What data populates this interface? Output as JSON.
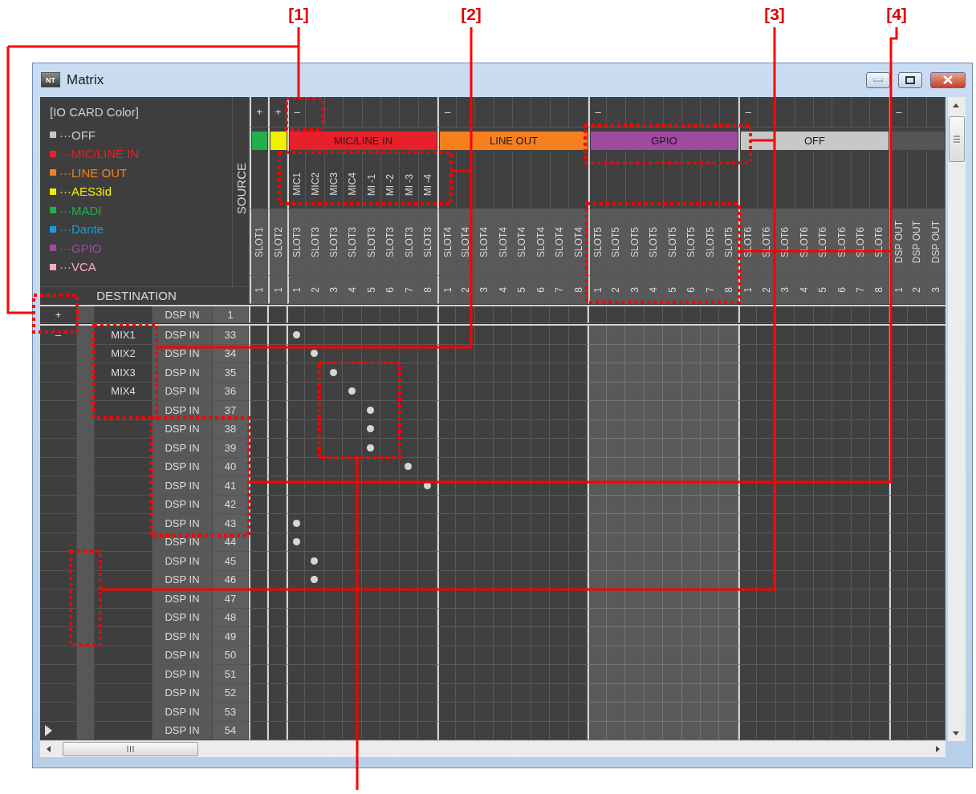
{
  "callouts": [
    {
      "label": "[1]"
    },
    {
      "label": "[2]"
    },
    {
      "label": "[3]"
    },
    {
      "label": "[4]"
    }
  ],
  "window": {
    "icon": "NT",
    "title": "Matrix"
  },
  "legend": {
    "title": "[IO CARD Color]",
    "items": [
      {
        "label": "···OFF",
        "color": "#c8c8c8"
      },
      {
        "label": "···MIC/LINE IN",
        "color": "#e8202a"
      },
      {
        "label": "···LINE OUT",
        "color": "#f7801e"
      },
      {
        "label": "···AES3id",
        "color": "#f0f000"
      },
      {
        "label": "···MADI",
        "color": "#22b04a"
      },
      {
        "label": "···Dante",
        "color": "#1a9be0"
      },
      {
        "label": "···GPIO",
        "color": "#a049a0"
      },
      {
        "label": "···VCA",
        "color": "#f7a8c8"
      }
    ]
  },
  "source_label": "SOURCE",
  "destination_label": "DESTINATION",
  "column_groups": [
    {
      "toggle": "+",
      "color": "#22b04a",
      "dimmed": false,
      "columns": [
        {
          "slot": "SLOT1",
          "number": "1"
        }
      ]
    },
    {
      "toggle": "+",
      "color": "#f0f000",
      "dimmed": false,
      "columns": [
        {
          "slot": "SLOT2",
          "number": "1"
        }
      ]
    },
    {
      "toggle": "–",
      "label": "MIC/LINE IN",
      "color": "#e8202a",
      "dimmed": false,
      "columns": [
        {
          "name": "MIC1",
          "slot": "SLOT3",
          "number": "1"
        },
        {
          "name": "MIC2",
          "slot": "SLOT3",
          "number": "2"
        },
        {
          "name": "MIC3",
          "slot": "SLOT3",
          "number": "3"
        },
        {
          "name": "MIC4",
          "slot": "SLOT3",
          "number": "4"
        },
        {
          "name": "MI -1",
          "slot": "SLOT3",
          "number": "5"
        },
        {
          "name": "MI -2",
          "slot": "SLOT3",
          "number": "6"
        },
        {
          "name": "MI -3",
          "slot": "SLOT3",
          "number": "7"
        },
        {
          "name": "MI -4",
          "slot": "SLOT3",
          "number": "8"
        }
      ]
    },
    {
      "toggle": "–",
      "label": "LINE OUT",
      "color": "#f7801e",
      "dimmed": false,
      "columns": [
        {
          "slot": "SLOT4",
          "number": "1"
        },
        {
          "slot": "SLOT4",
          "number": "2"
        },
        {
          "slot": "SLOT4",
          "number": "3"
        },
        {
          "slot": "SLOT4",
          "number": "4"
        },
        {
          "slot": "SLOT4",
          "number": "5"
        },
        {
          "slot": "SLOT4",
          "number": "6"
        },
        {
          "slot": "SLOT4",
          "number": "7"
        },
        {
          "slot": "SLOT4",
          "number": "8"
        }
      ]
    },
    {
      "toggle": "–",
      "label": "GPIO",
      "color": "#a049a0",
      "dimmed": true,
      "columns": [
        {
          "slot": "SLOT5",
          "number": "1"
        },
        {
          "slot": "SLOT5",
          "number": "2"
        },
        {
          "slot": "SLOT5",
          "number": "3"
        },
        {
          "slot": "SLOT5",
          "number": "4"
        },
        {
          "slot": "SLOT5",
          "number": "5"
        },
        {
          "slot": "SLOT5",
          "number": "6"
        },
        {
          "slot": "SLOT5",
          "number": "7"
        },
        {
          "slot": "SLOT5",
          "number": "8"
        }
      ]
    },
    {
      "toggle": "–",
      "label": "OFF",
      "color": "#c8c8c8",
      "dimmed": false,
      "columns": [
        {
          "slot": "SLOT6",
          "number": "1"
        },
        {
          "slot": "SLOT6",
          "number": "2"
        },
        {
          "slot": "SLOT6",
          "number": "3"
        },
        {
          "slot": "SLOT6",
          "number": "4"
        },
        {
          "slot": "SLOT6",
          "number": "5"
        },
        {
          "slot": "SLOT6",
          "number": "6"
        },
        {
          "slot": "SLOT6",
          "number": "7"
        },
        {
          "slot": "SLOT6",
          "number": "8"
        }
      ]
    },
    {
      "toggle": "–",
      "color": "#555555",
      "dimmed": false,
      "columns": [
        {
          "slot": "DSP OUT",
          "number": "1"
        },
        {
          "slot": "DSP OUT",
          "number": "2"
        },
        {
          "slot": "DSP OUT",
          "number": "3"
        }
      ]
    }
  ],
  "input_row": {
    "toggle": "+",
    "label": "DSP IN",
    "number": "1"
  },
  "rows": [
    {
      "toggle": "–",
      "mix": "MIX1",
      "label": "DSP IN",
      "number": "33",
      "current": false,
      "cells": [
        false,
        false,
        true,
        false,
        false,
        false,
        false,
        false,
        false,
        false,
        false,
        false,
        false,
        false,
        false,
        false,
        false,
        false,
        false,
        false,
        false,
        false,
        false,
        false,
        false,
        false,
        false,
        false,
        false,
        false,
        false,
        false,
        false,
        false,
        false,
        false,
        false
      ]
    },
    {
      "mix": "MIX2",
      "label": "DSP IN",
      "number": "34",
      "current": false,
      "cells": [
        false,
        false,
        false,
        true,
        false,
        false,
        false,
        false,
        false,
        false,
        false,
        false,
        false,
        false,
        false,
        false,
        false,
        false,
        false,
        false,
        false,
        false,
        false,
        false,
        false,
        false,
        false,
        false,
        false,
        false,
        false,
        false,
        false,
        false,
        false,
        false,
        false
      ]
    },
    {
      "mix": "MIX3",
      "label": "DSP IN",
      "number": "35",
      "current": false,
      "cells": [
        false,
        false,
        false,
        false,
        true,
        false,
        false,
        false,
        false,
        false,
        false,
        false,
        false,
        false,
        false,
        false,
        false,
        false,
        false,
        false,
        false,
        false,
        false,
        false,
        false,
        false,
        false,
        false,
        false,
        false,
        false,
        false,
        false,
        false,
        false,
        false,
        false
      ]
    },
    {
      "mix": "MIX4",
      "label": "DSP IN",
      "number": "36",
      "current": false,
      "cells": [
        false,
        false,
        false,
        false,
        false,
        true,
        false,
        false,
        false,
        false,
        false,
        false,
        false,
        false,
        false,
        false,
        false,
        false,
        false,
        false,
        false,
        false,
        false,
        false,
        false,
        false,
        false,
        false,
        false,
        false,
        false,
        false,
        false,
        false,
        false,
        false,
        false
      ]
    },
    {
      "label": "DSP IN",
      "number": "37",
      "current": false,
      "cells": [
        false,
        false,
        false,
        false,
        false,
        false,
        true,
        false,
        false,
        false,
        false,
        false,
        false,
        false,
        false,
        false,
        false,
        false,
        false,
        false,
        false,
        false,
        false,
        false,
        false,
        false,
        false,
        false,
        false,
        false,
        false,
        false,
        false,
        false,
        false,
        false,
        false
      ]
    },
    {
      "label": "DSP IN",
      "number": "38",
      "current": false,
      "cells": [
        false,
        false,
        false,
        false,
        false,
        false,
        true,
        false,
        false,
        false,
        false,
        false,
        false,
        false,
        false,
        false,
        false,
        false,
        false,
        false,
        false,
        false,
        false,
        false,
        false,
        false,
        false,
        false,
        false,
        false,
        false,
        false,
        false,
        false,
        false,
        false,
        false
      ]
    },
    {
      "label": "DSP IN",
      "number": "39",
      "current": false,
      "cells": [
        false,
        false,
        false,
        false,
        false,
        false,
        true,
        false,
        false,
        false,
        false,
        false,
        false,
        false,
        false,
        false,
        false,
        false,
        false,
        false,
        false,
        false,
        false,
        false,
        false,
        false,
        false,
        false,
        false,
        false,
        false,
        false,
        false,
        false,
        false,
        false,
        false
      ]
    },
    {
      "label": "DSP IN",
      "number": "40",
      "current": false,
      "cells": [
        false,
        false,
        false,
        false,
        false,
        false,
        false,
        false,
        true,
        false,
        false,
        false,
        false,
        false,
        false,
        false,
        false,
        false,
        false,
        false,
        false,
        false,
        false,
        false,
        false,
        false,
        false,
        false,
        false,
        false,
        false,
        false,
        false,
        false,
        false,
        false,
        false
      ]
    },
    {
      "label": "DSP IN",
      "number": "41",
      "current": false,
      "cells": [
        false,
        false,
        false,
        false,
        false,
        false,
        false,
        false,
        false,
        true,
        false,
        false,
        false,
        false,
        false,
        false,
        false,
        false,
        false,
        false,
        false,
        false,
        false,
        false,
        false,
        false,
        false,
        false,
        false,
        false,
        false,
        false,
        false,
        false,
        false,
        false,
        false
      ]
    },
    {
      "label": "DSP IN",
      "number": "42",
      "current": false,
      "cells": [
        false,
        false,
        false,
        false,
        false,
        false,
        false,
        false,
        false,
        false,
        false,
        false,
        false,
        false,
        false,
        false,
        false,
        false,
        false,
        false,
        false,
        false,
        false,
        false,
        false,
        false,
        false,
        false,
        false,
        false,
        false,
        false,
        false,
        false,
        false,
        false,
        false
      ]
    },
    {
      "label": "DSP IN",
      "number": "43",
      "current": false,
      "cells": [
        false,
        false,
        true,
        false,
        false,
        false,
        false,
        false,
        false,
        false,
        false,
        false,
        false,
        false,
        false,
        false,
        false,
        false,
        false,
        false,
        false,
        false,
        false,
        false,
        false,
        false,
        false,
        false,
        false,
        false,
        false,
        false,
        false,
        false,
        false,
        false,
        false
      ]
    },
    {
      "label": "DSP IN",
      "number": "44",
      "current": false,
      "cells": [
        false,
        false,
        true,
        false,
        false,
        false,
        false,
        false,
        false,
        false,
        false,
        false,
        false,
        false,
        false,
        false,
        false,
        false,
        false,
        false,
        false,
        false,
        false,
        false,
        false,
        false,
        false,
        false,
        false,
        false,
        false,
        false,
        false,
        false,
        false,
        false,
        false
      ]
    },
    {
      "label": "DSP IN",
      "number": "45",
      "current": false,
      "cells": [
        false,
        false,
        false,
        true,
        false,
        false,
        false,
        false,
        false,
        false,
        false,
        false,
        false,
        false,
        false,
        false,
        false,
        false,
        false,
        false,
        false,
        false,
        false,
        false,
        false,
        false,
        false,
        false,
        false,
        false,
        false,
        false,
        false,
        false,
        false,
        false,
        false
      ]
    },
    {
      "label": "DSP IN",
      "number": "46",
      "current": false,
      "cells": [
        false,
        false,
        false,
        true,
        false,
        false,
        false,
        false,
        false,
        false,
        false,
        false,
        false,
        false,
        false,
        false,
        false,
        false,
        false,
        false,
        false,
        false,
        false,
        false,
        false,
        false,
        false,
        false,
        false,
        false,
        false,
        false,
        false,
        false,
        false,
        false,
        false
      ]
    },
    {
      "label": "DSP IN",
      "number": "47",
      "current": false,
      "cells": [
        false,
        false,
        false,
        false,
        false,
        false,
        false,
        false,
        false,
        false,
        false,
        false,
        false,
        false,
        false,
        false,
        false,
        false,
        false,
        false,
        false,
        false,
        false,
        false,
        false,
        false,
        false,
        false,
        false,
        false,
        false,
        false,
        false,
        false,
        false,
        false,
        false
      ]
    },
    {
      "label": "DSP IN",
      "number": "48",
      "current": false,
      "cells": [
        false,
        false,
        false,
        false,
        false,
        false,
        false,
        false,
        false,
        false,
        false,
        false,
        false,
        false,
        false,
        false,
        false,
        false,
        false,
        false,
        false,
        false,
        false,
        false,
        false,
        false,
        false,
        false,
        false,
        false,
        false,
        false,
        false,
        false,
        false,
        false,
        false
      ]
    },
    {
      "label": "DSP IN",
      "number": "49",
      "current": false,
      "cells": [
        false,
        false,
        false,
        false,
        false,
        false,
        false,
        false,
        false,
        false,
        false,
        false,
        false,
        false,
        false,
        false,
        false,
        false,
        false,
        false,
        false,
        false,
        false,
        false,
        false,
        false,
        false,
        false,
        false,
        false,
        false,
        false,
        false,
        false,
        false,
        false,
        false
      ]
    },
    {
      "label": "DSP IN",
      "number": "50",
      "current": false,
      "cells": [
        false,
        false,
        false,
        false,
        false,
        false,
        false,
        false,
        false,
        false,
        false,
        false,
        false,
        false,
        false,
        false,
        false,
        false,
        false,
        false,
        false,
        false,
        false,
        false,
        false,
        false,
        false,
        false,
        false,
        false,
        false,
        false,
        false,
        false,
        false,
        false,
        false
      ]
    },
    {
      "label": "DSP IN",
      "number": "51",
      "current": false,
      "cells": [
        false,
        false,
        false,
        false,
        false,
        false,
        false,
        false,
        false,
        false,
        false,
        false,
        false,
        false,
        false,
        false,
        false,
        false,
        false,
        false,
        false,
        false,
        false,
        false,
        false,
        false,
        false,
        false,
        false,
        false,
        false,
        false,
        false,
        false,
        false,
        false,
        false
      ]
    },
    {
      "label": "DSP IN",
      "number": "52",
      "current": false,
      "cells": [
        false,
        false,
        false,
        false,
        false,
        false,
        false,
        false,
        false,
        false,
        false,
        false,
        false,
        false,
        false,
        false,
        false,
        false,
        false,
        false,
        false,
        false,
        false,
        false,
        false,
        false,
        false,
        false,
        false,
        false,
        false,
        false,
        false,
        false,
        false,
        false,
        false
      ]
    },
    {
      "label": "DSP IN",
      "number": "53",
      "current": false,
      "cells": [
        false,
        false,
        false,
        false,
        false,
        false,
        false,
        false,
        false,
        false,
        false,
        false,
        false,
        false,
        false,
        false,
        false,
        false,
        false,
        false,
        false,
        false,
        false,
        false,
        false,
        false,
        false,
        false,
        false,
        false,
        false,
        false,
        false,
        false,
        false,
        false,
        false
      ]
    },
    {
      "label": "DSP IN",
      "number": "54",
      "current": true,
      "cells": [
        false,
        false,
        false,
        false,
        false,
        false,
        false,
        false,
        false,
        false,
        false,
        false,
        false,
        false,
        false,
        false,
        false,
        false,
        false,
        false,
        false,
        false,
        false,
        false,
        false,
        false,
        false,
        false,
        false,
        false,
        false,
        false,
        false,
        false,
        false,
        false,
        false
      ]
    }
  ]
}
